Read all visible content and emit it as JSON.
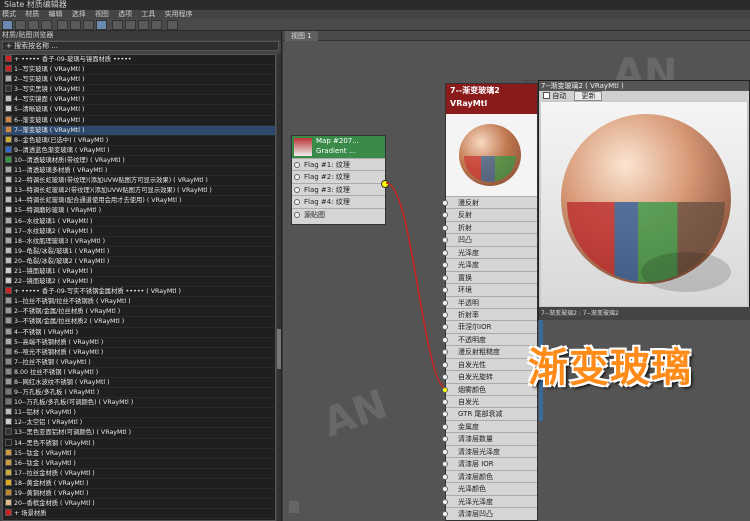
{
  "window": {
    "title": "Slate 材质编辑器"
  },
  "menu": [
    "模式",
    "材质",
    "编辑",
    "选择",
    "视图",
    "选项",
    "工具",
    "实用程序"
  ],
  "browser": {
    "title": "材质/贴图浏览器",
    "search": "+ 搜索按名称 ...",
    "items": [
      {
        "label": "+ ••••• 香子-09-玻璃与镜面材质 •••••",
        "color": "#cc2222"
      },
      {
        "label": "1--写实玻璃  ( VRayMtl )",
        "color": "#cc2222"
      },
      {
        "label": "2--写实玻璃  ( VRayMtl )",
        "color": "#aaaaaa"
      },
      {
        "label": "3--写实黑镜  ( VRayMtl )",
        "color": "#333333"
      },
      {
        "label": "4--写实镜面  ( VRayMtl )",
        "color": "#bbbbbb"
      },
      {
        "label": "5--清晰玻璃  ( VRayMtl )",
        "color": "#cccccc"
      },
      {
        "label": "6--渐变玻璃  ( VRayMtl )",
        "color": "#cc8844"
      },
      {
        "label": "7--渐变玻璃  ( VRayMtl )",
        "color": "#cc8844",
        "selected": true
      },
      {
        "label": "8--金色玻璃(已选中)  ( VRayMtl )",
        "color": "#ccaa33"
      },
      {
        "label": "9--清透蓝色渐变玻璃  ( VRayMtl )",
        "color": "#3366cc"
      },
      {
        "label": "10--清透玻璃材质(带纹理)  ( VRayMtl )",
        "color": "#339944"
      },
      {
        "label": "11--清透玻璃多材质  ( VRayMtl )",
        "color": "#aaaaaa"
      },
      {
        "label": "12--特调长虹玻璃(带纹理)(添加UVW贴图方可显示效果)  ( VRayMtl )",
        "color": "#bbbbbb"
      },
      {
        "label": "13--特调长虹玻璃2(带纹理)(添加UVW贴图方可显示效果)  ( VRayMtl )",
        "color": "#bbbbbb"
      },
      {
        "label": "14--特调长虹玻璃(配合通道使用会用才去使用)  ( VRayMtl )",
        "color": "#bbbbbb"
      },
      {
        "label": "15--特调磨砂玻璃  ( VRayMtl )",
        "color": "#cccccc"
      },
      {
        "label": "16--水纹玻璃1  ( VRayMtl )",
        "color": "#aaaaaa"
      },
      {
        "label": "17--水纹玻璃2  ( VRayMtl )",
        "color": "#aaaaaa"
      },
      {
        "label": "18--水纹肌理玻璃3  ( VRayMtl )",
        "color": "#aaaaaa"
      },
      {
        "label": "19--龟裂/冰裂/玻璃1  ( VRayMtl )",
        "color": "#bbbbbb"
      },
      {
        "label": "20--龟裂/冰裂/玻璃2  ( VRayMtl )",
        "color": "#bbbbbb"
      },
      {
        "label": "21--镜面玻璃1  ( VRayMtl )",
        "color": "#cccccc"
      },
      {
        "label": "22--镜面玻璃2  ( VRayMtl )",
        "color": "#cccccc"
      },
      {
        "label": "+ ••••• 香子-09-写实不锈钢金属材质 •••••  ( VRayMtl )",
        "color": "#cc2222"
      },
      {
        "label": "1--拉丝不锈钢/拉丝不锈钢质  ( VRayMtl )",
        "color": "#999999"
      },
      {
        "label": "2--不锈钢/金属/拉丝材质  ( VRayMtl )",
        "color": "#999999"
      },
      {
        "label": "3--不锈钢/金属/拉丝材质2  ( VRayMtl )",
        "color": "#999999"
      },
      {
        "label": "4--不锈钢  ( VRayMtl )",
        "color": "#999999"
      },
      {
        "label": "5--高端不锈钢材质  ( VRayMtl )",
        "color": "#aaaaaa"
      },
      {
        "label": "6--哑光不锈钢材质  ( VRayMtl )",
        "color": "#888888"
      },
      {
        "label": "7--拉丝不锈钢  ( VRayMtl )",
        "color": "#888888"
      },
      {
        "label": "8.00 拉丝不锈钢  ( VRayMtl )",
        "color": "#888888"
      },
      {
        "label": "8--网红水波纹不锈钢  ( VRayMtl )",
        "color": "#999999"
      },
      {
        "label": "9--万孔板/多孔板  ( VRayMtl )",
        "color": "#777777"
      },
      {
        "label": "10--万孔板/多孔板(可调颜色)  ( VRayMtl )",
        "color": "#777777"
      },
      {
        "label": "11--铝材  ( VRayMtl )",
        "color": "#bbbbbb"
      },
      {
        "label": "12--太空铝  ( VRayMtl )",
        "color": "#cccccc"
      },
      {
        "label": "13--黑色亚面铝材(可调颜色)  ( VRayMtl )",
        "color": "#333333"
      },
      {
        "label": "14--黑色不锈钢  ( VRayMtl )",
        "color": "#222222"
      },
      {
        "label": "15--钛金  ( VRayMtl )",
        "color": "#cc9944"
      },
      {
        "label": "16--钛金  ( VRayMtl )",
        "color": "#cc9944"
      },
      {
        "label": "17--拉丝金材质  ( VRayMtl )",
        "color": "#ccaa44"
      },
      {
        "label": "18--黄金材质  ( VRayMtl )",
        "color": "#ddaa22"
      },
      {
        "label": "19--黄铜材质  ( VRayMtl )",
        "color": "#bb8833"
      },
      {
        "label": "20--香槟金材质  ( VRayMtl )",
        "color": "#ddbb88"
      },
      {
        "label": "+ 场景材质",
        "color": "#cc2222"
      }
    ]
  },
  "view": {
    "tab": "视图 1"
  },
  "gradient_node": {
    "title": "Map #207...",
    "subtitle": "Gradient ...",
    "rows": [
      "Flag #1: 纹理",
      "Flag #2: 纹理",
      "Flag #3: 纹理",
      "Flag #4: 纹理",
      "源贴图"
    ]
  },
  "material_node": {
    "title": "7--渐变玻璃2",
    "type": "VRayMtl",
    "rows": [
      "漫反射",
      "反射",
      "折射",
      "凹凸",
      "光泽度",
      "光泽度",
      "置换",
      "环境",
      "半透明",
      "折射率",
      "菲涅尔IOR",
      "不透明度",
      "漫反射粗糙度",
      "自发光性",
      "自发光旋转",
      "烟雾颜色",
      "自发光",
      "GTR 尾部衰减",
      "金属度",
      "清漆层数量",
      "清漆层光泽度",
      "清漆层 IOR",
      "清漆层颜色",
      "光泽颜色",
      "光泽光泽度",
      "清漆层凹凸"
    ]
  },
  "preview": {
    "title": "7--渐变玻璃2 ( VRayMtl )",
    "auto_label": "自动",
    "update_label": "更新",
    "footer": "7--渐变玻璃2 : 7--渐变玻璃2"
  },
  "overlay": {
    "caption": "渐变玻璃"
  },
  "colors": {
    "accent_orange": "#ff8c1a",
    "node_header_red": "#8b1a1a",
    "node_header_green": "#3a8a4a",
    "selection_blue": "#2d4a6e"
  }
}
